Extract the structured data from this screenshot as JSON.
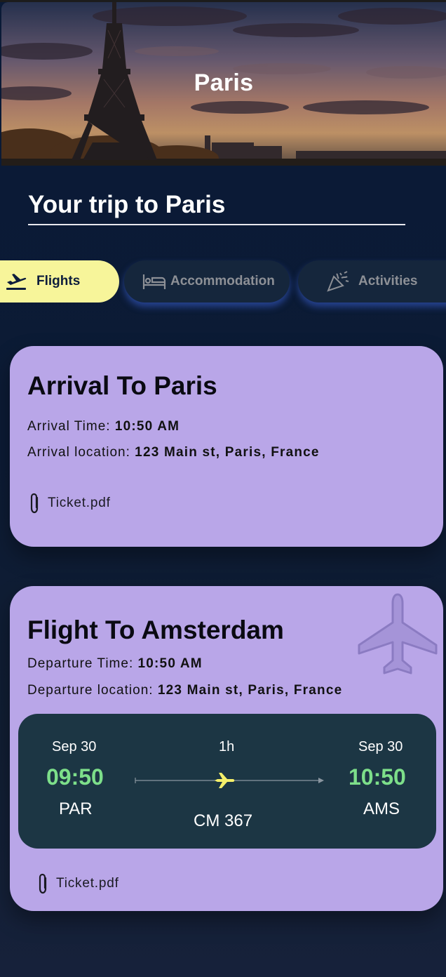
{
  "hero": {
    "title": "Paris"
  },
  "trip": {
    "title": "Your trip to Paris"
  },
  "tabs": [
    {
      "label": "Flights",
      "icon": "plane-departure-icon",
      "active": true
    },
    {
      "label": "Accommodation",
      "icon": "bed-icon",
      "active": false
    },
    {
      "label": "Activities",
      "icon": "party-popper-icon",
      "active": false
    }
  ],
  "cards": [
    {
      "title": "Arrival To Paris",
      "lines": [
        {
          "label": "Arrival Time: ",
          "value": "10:50 AM"
        },
        {
          "label": "Arrival location: ",
          "value": "123 Main st, Paris, France"
        }
      ],
      "attachment": "Ticket.pdf"
    },
    {
      "title": "Flight To Amsterdam",
      "watermark_icon": "airplane-icon",
      "lines": [
        {
          "label": "Departure Time: ",
          "value": "10:50 AM"
        },
        {
          "label": "Departure location: ",
          "value": "123 Main st, Paris, France"
        }
      ],
      "flight": {
        "dep_date": "Sep 30",
        "dep_time": "09:50",
        "dep_code": "PAR",
        "duration": "1h",
        "arr_date": "Sep 30",
        "arr_time": "10:50",
        "arr_code": "AMS",
        "flight_number": "CM 367"
      },
      "attachment": "Ticket.pdf"
    }
  ],
  "colors": {
    "background": "#0b1a33",
    "active_tab": "#f7f59a",
    "inactive_tab": "#15263c",
    "card": "#b9a6e8",
    "flight_box": "#1c3644",
    "time_green": "#7ddf8a",
    "route_plane": "#f4ef6a"
  }
}
